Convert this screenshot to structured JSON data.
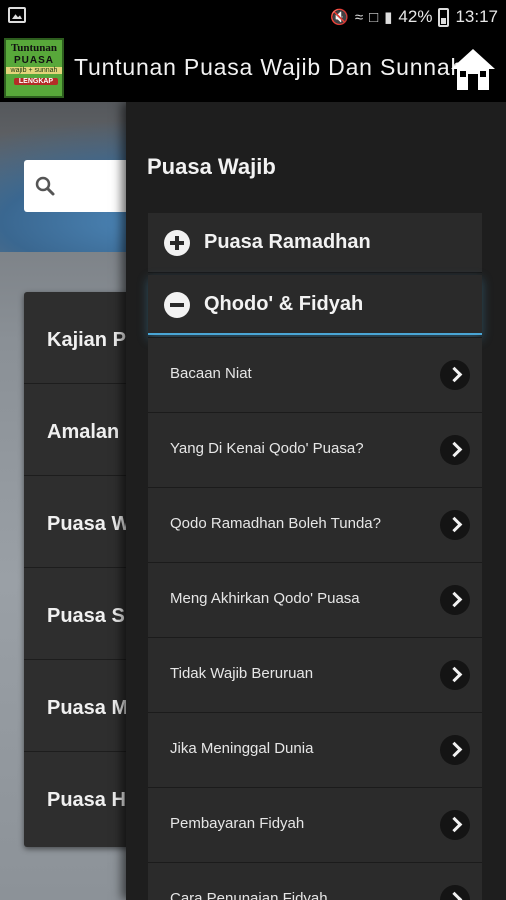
{
  "status_bar": {
    "battery": "42%",
    "time": "13:17"
  },
  "app_bar": {
    "title": "Tuntunan Puasa Wajib Dan Sunnah",
    "logo": {
      "line1": "Tuntunan",
      "line2": "PUASA",
      "line3": "wajib + sunnah",
      "line4": "LENGKAP"
    }
  },
  "main": {
    "menu_items": [
      "Kajian P",
      "Amalan",
      "Puasa W",
      "Puasa S",
      "Puasa M",
      "Puasa H"
    ]
  },
  "drawer": {
    "title": "Puasa Wajib",
    "groups": [
      {
        "label": "Puasa Ramadhan",
        "expanded": false
      },
      {
        "label": "Qhodo' & Fidyah",
        "expanded": true
      }
    ],
    "sub_items": [
      "Bacaan Niat",
      "Yang Di Kenai Qodo' Puasa?",
      "Qodo Ramadhan Boleh Tunda?",
      "Meng Akhirkan Qodo' Puasa",
      "Tidak Wajib Beruruan",
      "Jika Meninggal Dunia",
      "Pembayaran Fidyah",
      "Cara Penunaian Fidyah"
    ]
  },
  "colors": {
    "app_bar_bg": "#000000",
    "drawer_bg": "#1e1e1e",
    "item_bg": "#2b2b2b",
    "active_accent": "#4aa6d6",
    "logo_green": "#58a83a"
  },
  "icons": {
    "notification": "image-icon",
    "home": "home-icon",
    "search": "search-icon",
    "expand": "plus-circle-icon",
    "collapse": "minus-circle-icon",
    "item_arrow": "chevron-right-icon"
  }
}
